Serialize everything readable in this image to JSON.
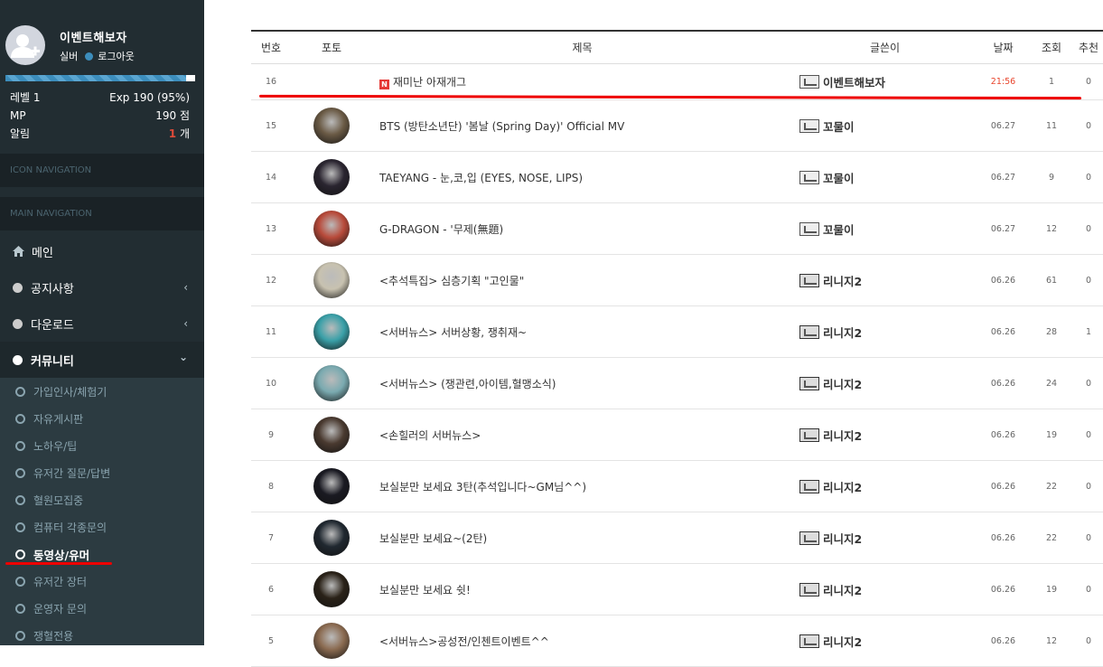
{
  "user": {
    "name": "이벤트해보자",
    "grade": "실버",
    "logout": "로그아웃",
    "exp_fraction": 0.95,
    "stats": [
      {
        "label": "레벨 1",
        "value": "Exp 190 (95%)"
      },
      {
        "label": "MP",
        "value": "190 점"
      },
      {
        "label": "알림",
        "count": "1",
        "unit": "개"
      }
    ]
  },
  "nav": {
    "icon_nav_header": "ICON NAVIGATION",
    "main_nav_header": "MAIN NAVIGATION",
    "items": [
      {
        "label": "메인",
        "icon": "home-icon"
      },
      {
        "label": "공지사항",
        "icon": "circle-icon",
        "chevron": "‹"
      },
      {
        "label": "다운로드",
        "icon": "circle-icon",
        "chevron": "‹"
      },
      {
        "label": "커뮤니티",
        "icon": "circle-icon",
        "chevron": "⌄"
      }
    ],
    "sub_items": [
      "가입인사/체험기",
      "자유게시판",
      "노하우/팁",
      "유저간 질문/답변",
      "혈원모집중",
      "컴퓨터 각종문의",
      "동영상/유머",
      "유저간 장터",
      "운영자 문의",
      "쟁혈전용"
    ],
    "current_sub_index": 6
  },
  "board": {
    "headers": {
      "no": "번호",
      "photo": "포토",
      "title": "제목",
      "writer": "글쓴이",
      "date": "날짜",
      "views": "조회",
      "rec": "추천"
    },
    "rows": [
      {
        "no": "16",
        "title": "재미난 아재개그",
        "is_new": true,
        "new_badge": "N",
        "writer": "이벤트해보자",
        "date": "21:56",
        "views": "1",
        "rec": "0",
        "thumb": null
      },
      {
        "no": "15",
        "title": "BTS (방탄소년단) '봄날 (Spring Day)' Official MV",
        "writer": "꼬물이",
        "date": "06.27",
        "views": "11",
        "rec": "0",
        "thumb": "#6a5a45"
      },
      {
        "no": "14",
        "title": "TAEYANG - 눈,코,입 (EYES, NOSE, LIPS)",
        "writer": "꼬물이",
        "date": "06.27",
        "views": "9",
        "rec": "0",
        "thumb": "#2a2530"
      },
      {
        "no": "13",
        "title": "G-DRAGON - '무제(無題)",
        "writer": "꼬물이",
        "date": "06.27",
        "views": "12",
        "rec": "0",
        "thumb": "#b84a3a"
      },
      {
        "no": "12",
        "title": "<추석특집> 심층기획 \"고인물\"",
        "writer": "리니지2",
        "date": "06.26",
        "views": "61",
        "rec": "0",
        "thumb": "#c8c2b0"
      },
      {
        "no": "11",
        "title": "<서버뉴스> 서버상황, 쟁취재~",
        "writer": "리니지2",
        "date": "06.26",
        "views": "28",
        "rec": "1",
        "thumb": "#3aa0a8"
      },
      {
        "no": "10",
        "title": "<서버뉴스> (쟁관련,아이템,혈맹소식)",
        "writer": "리니지2",
        "date": "06.26",
        "views": "24",
        "rec": "0",
        "thumb": "#7aaab0"
      },
      {
        "no": "9",
        "title": "<손힐러의 서버뉴스>",
        "writer": "리니지2",
        "date": "06.26",
        "views": "19",
        "rec": "0",
        "thumb": "#4a3a30"
      },
      {
        "no": "8",
        "title": "보실분만 보세요 3탄(추석입니다~GM님^^)",
        "writer": "리니지2",
        "date": "06.26",
        "views": "22",
        "rec": "0",
        "thumb": "#1a1a22"
      },
      {
        "no": "7",
        "title": "보실분만 보세요~(2탄)",
        "writer": "리니지2",
        "date": "06.26",
        "views": "22",
        "rec": "0",
        "thumb": "#202830"
      },
      {
        "no": "6",
        "title": "보실분만 보세요 쉿!",
        "writer": "리니지2",
        "date": "06.26",
        "views": "19",
        "rec": "0",
        "thumb": "#2a2218"
      },
      {
        "no": "5",
        "title": "<서버뉴스>공성전/인첸트이벤트^^",
        "writer": "리니지2",
        "date": "06.26",
        "views": "12",
        "rec": "0",
        "thumb": "#8a6a50"
      }
    ]
  },
  "colors": {
    "sidebar_bg": "#222d32",
    "accent": "#3c8dbc",
    "new_date": "#e8452c",
    "highlight_line": "#e00000"
  }
}
